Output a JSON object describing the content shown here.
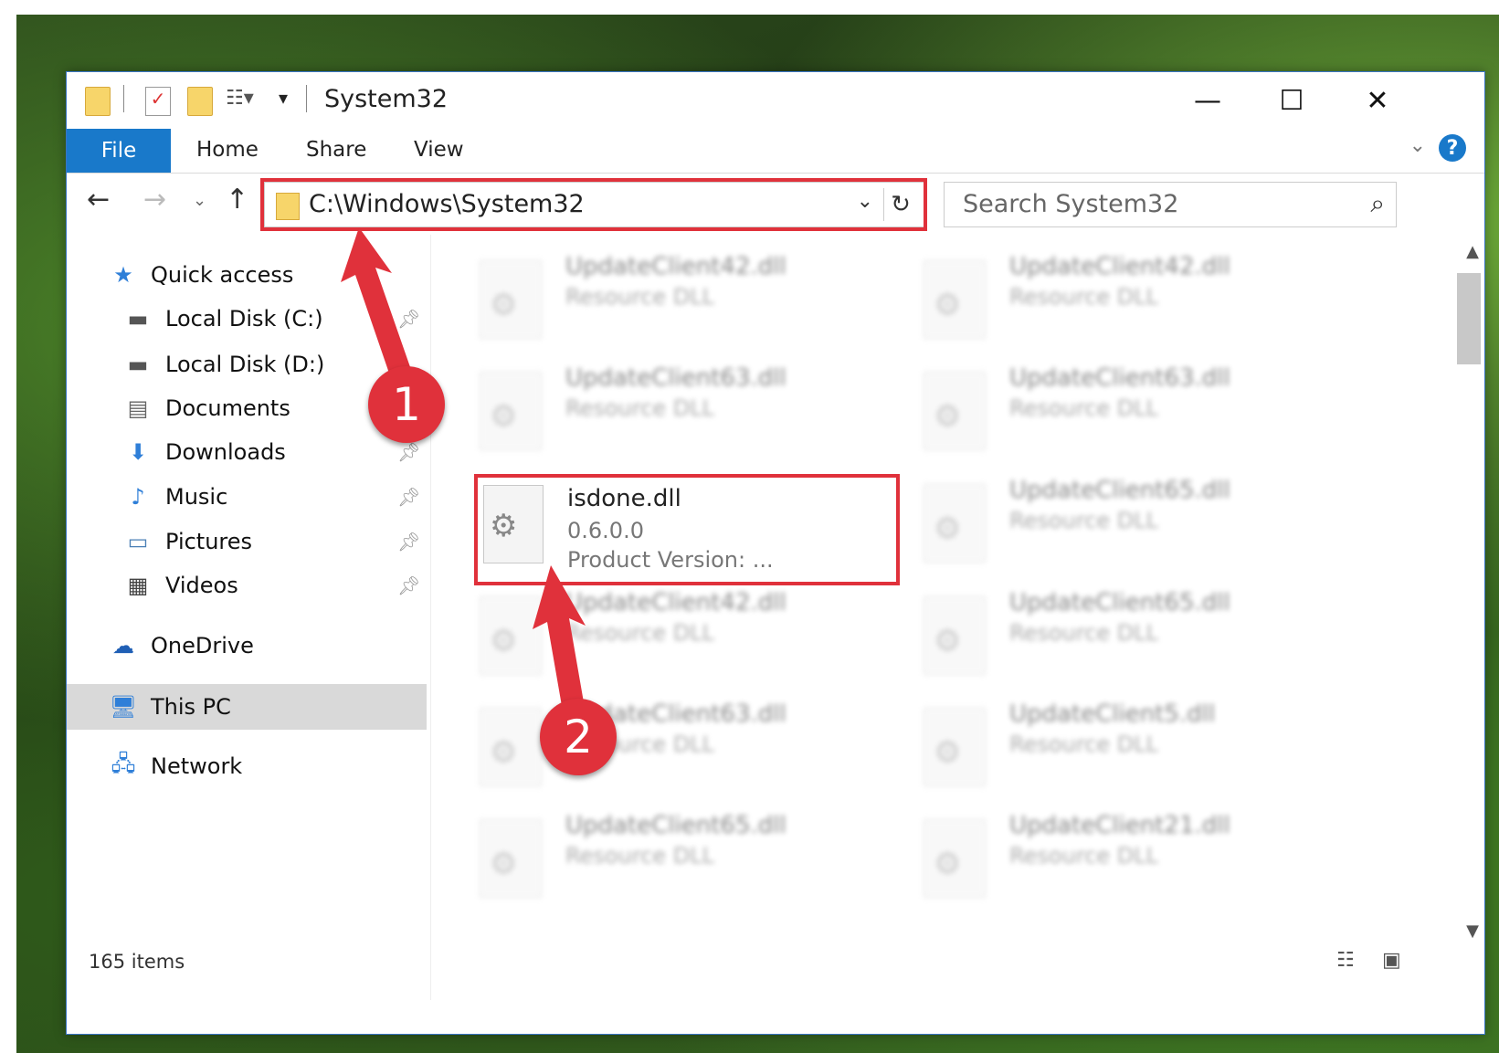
{
  "window": {
    "title": "System32",
    "minimize_glyph": "—",
    "maximize_glyph": "☐",
    "close_glyph": "✕"
  },
  "ribbon": {
    "file": "File",
    "home": "Home",
    "share": "Share",
    "view": "View",
    "help_glyph": "?"
  },
  "nav": {
    "address": "C:\\Windows\\System32",
    "search_placeholder": "Search System32"
  },
  "sidebar": {
    "items": [
      {
        "label": "Quick access",
        "icon": "star-icon"
      },
      {
        "label": "Local Disk (C:)",
        "icon": "drive-icon"
      },
      {
        "label": "Local Disk (D:)",
        "icon": "drive-icon"
      },
      {
        "label": "Documents",
        "icon": "documents-icon"
      },
      {
        "label": "Downloads",
        "icon": "download-icon"
      },
      {
        "label": "Music",
        "icon": "music-icon"
      },
      {
        "label": "Pictures",
        "icon": "pictures-icon"
      },
      {
        "label": "Videos",
        "icon": "videos-icon"
      },
      {
        "label": "OneDrive",
        "icon": "cloud-icon"
      },
      {
        "label": "This PC",
        "icon": "computer-icon"
      },
      {
        "label": "Network",
        "icon": "network-icon"
      }
    ]
  },
  "files": [
    {
      "name": "UpdateClient42.dll",
      "sub": "Resource DLL"
    },
    {
      "name": "UpdateClient42.dll",
      "sub": "Resource DLL"
    },
    {
      "name": "UpdateClient63.dll",
      "sub": "Resource DLL"
    },
    {
      "name": "UpdateClient63.dll",
      "sub": "Resource DLL"
    },
    {
      "name": "UpdateClient65.dll",
      "sub": "Resource DLL"
    },
    {
      "name": "UpdateClient42.dll",
      "sub": "Resource DLL"
    },
    {
      "name": "UpdateClient65.dll",
      "sub": "Resource DLL"
    },
    {
      "name": "UpdateClient63.dll",
      "sub": "Resource DLL"
    },
    {
      "name": "UpdateClient5.dll",
      "sub": "Resource DLL"
    },
    {
      "name": "UpdateClient65.dll",
      "sub": "Resource DLL"
    },
    {
      "name": "UpdateClient21.dll",
      "sub": "Resource DLL"
    }
  ],
  "selected_file": {
    "name": "isdone.dll",
    "version": "0.6.0.0",
    "product_version": "Product Version:    ..."
  },
  "status": {
    "items": "165 items"
  },
  "callouts": {
    "one": "1",
    "two": "2"
  },
  "colors": {
    "accent": "#1979ca",
    "highlight": "#e0313b"
  }
}
